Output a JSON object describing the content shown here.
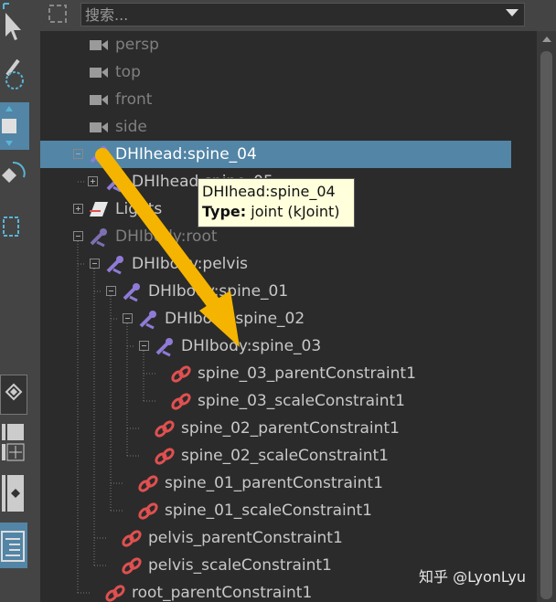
{
  "search": {
    "placeholder": "搜索..."
  },
  "rows": [
    {
      "label": "persp",
      "type": "camera",
      "state": "dim"
    },
    {
      "label": "top",
      "type": "camera",
      "state": "dim"
    },
    {
      "label": "front",
      "type": "camera",
      "state": "dim"
    },
    {
      "label": "side",
      "type": "camera",
      "state": "dim"
    },
    {
      "label": "DHIhead:spine_04",
      "type": "joint",
      "state": "selected"
    },
    {
      "label": "DHIhead:spine_05",
      "type": "joint",
      "state": "normal"
    },
    {
      "label": "Lights",
      "type": "lights",
      "state": "normal"
    },
    {
      "label": "DHIbody:root",
      "type": "joint",
      "state": "dim"
    },
    {
      "label": "DHIbody:pelvis",
      "type": "joint",
      "state": "normal"
    },
    {
      "label": "DHIbody:spine_01",
      "type": "joint",
      "state": "normal"
    },
    {
      "label": "DHIbody:spine_02",
      "type": "joint",
      "state": "normal"
    },
    {
      "label": "DHIbody:spine_03",
      "type": "joint",
      "state": "normal"
    },
    {
      "label": "spine_03_parentConstraint1",
      "type": "constraint",
      "state": "normal"
    },
    {
      "label": "spine_03_scaleConstraint1",
      "type": "constraint",
      "state": "normal"
    },
    {
      "label": "spine_02_parentConstraint1",
      "type": "constraint",
      "state": "normal"
    },
    {
      "label": "spine_02_scaleConstraint1",
      "type": "constraint",
      "state": "normal"
    },
    {
      "label": "spine_01_parentConstraint1",
      "type": "constraint",
      "state": "normal"
    },
    {
      "label": "spine_01_scaleConstraint1",
      "type": "constraint",
      "state": "normal"
    },
    {
      "label": "pelvis_parentConstraint1",
      "type": "constraint",
      "state": "normal"
    },
    {
      "label": "pelvis_scaleConstraint1",
      "type": "constraint",
      "state": "normal"
    },
    {
      "label": "root_parentConstraint1",
      "type": "constraint",
      "state": "normal"
    }
  ],
  "tooltip": {
    "name": "DHIhead:spine_04",
    "type_label": "Type:",
    "type_value": "joint (kJoint)"
  },
  "watermark": "知乎 @LyonLyu",
  "colors": {
    "selection": "#5285a6",
    "joint": "#8f7bd6",
    "constraint": "#e05050",
    "arrow": "#f5b400",
    "tooltip_bg": "#ffffdc"
  }
}
